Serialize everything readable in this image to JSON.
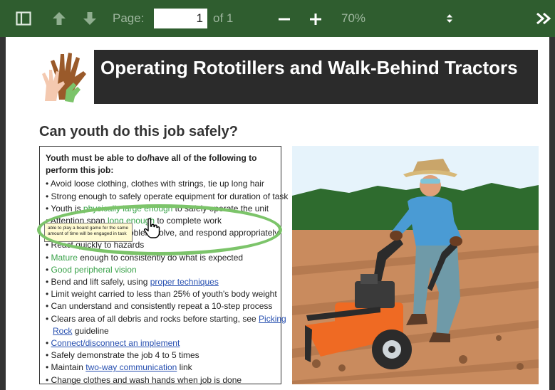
{
  "toolbar": {
    "page_label": "Page:",
    "page_value": "1",
    "page_of": "of 1",
    "zoom_value": "70%"
  },
  "document": {
    "title": "Operating Rototillers and Walk-Behind Tractors",
    "heading": "Can youth do this job safely?",
    "intro": "Youth must be able to do/have all of the following to perform this job:",
    "items": {
      "i1": "Avoid loose clothing, clothes with strings, tie up long hair",
      "i2": "Strong enough to safely operate equipment for duration of task",
      "i3_a": "Youth is ",
      "i3_b": "physically large enough",
      "i3_c": " to safely operate the unit",
      "i4_a": "Attention span ",
      "i4_b": "long enough",
      "i4_c": " to complete work",
      "i5": "Able to recognize, problem solve, and respond appropriately",
      "i6": "React quickly to hazards",
      "i7_a": "Mature",
      "i7_b": " enough to consistently do what is expected",
      "i8": "Good peripheral vision",
      "i9_a": "Bend and lift safely, using ",
      "i9_b": "proper techniques",
      "i10": "Limit weight carried to less than 25% of youth's body weight",
      "i11": "Can understand and consistently repeat a 10-step process",
      "i12_a": "Clears area of all debris and rocks before starting, see ",
      "i12_b": "Picking",
      "i12_c": "Rock",
      "i12_d": " guideline",
      "i13": "Connect/disconnect an implement",
      "i14": "Safely demonstrate the job 4 to 5 times",
      "i15_a": "Maintain ",
      "i15_b": "two-way communication",
      "i15_c": " link",
      "i16": "Change clothes and wash hands when job is done"
    },
    "tooltip": "able to play a board game for the same amount of time will be engaged in task"
  },
  "colors": {
    "toolbar": "#2f5d2f",
    "banner": "#2b2b2b",
    "highlight": "#7cc46a",
    "link": "#2850b0",
    "green_text": "#3aa24a"
  },
  "icons": [
    "sidebar-toggle-icon",
    "previous-page-icon",
    "next-page-icon",
    "zoom-out-icon",
    "zoom-in-icon",
    "zoom-dropdown-icon",
    "more-tools-icon",
    "hand-cursor-icon"
  ]
}
